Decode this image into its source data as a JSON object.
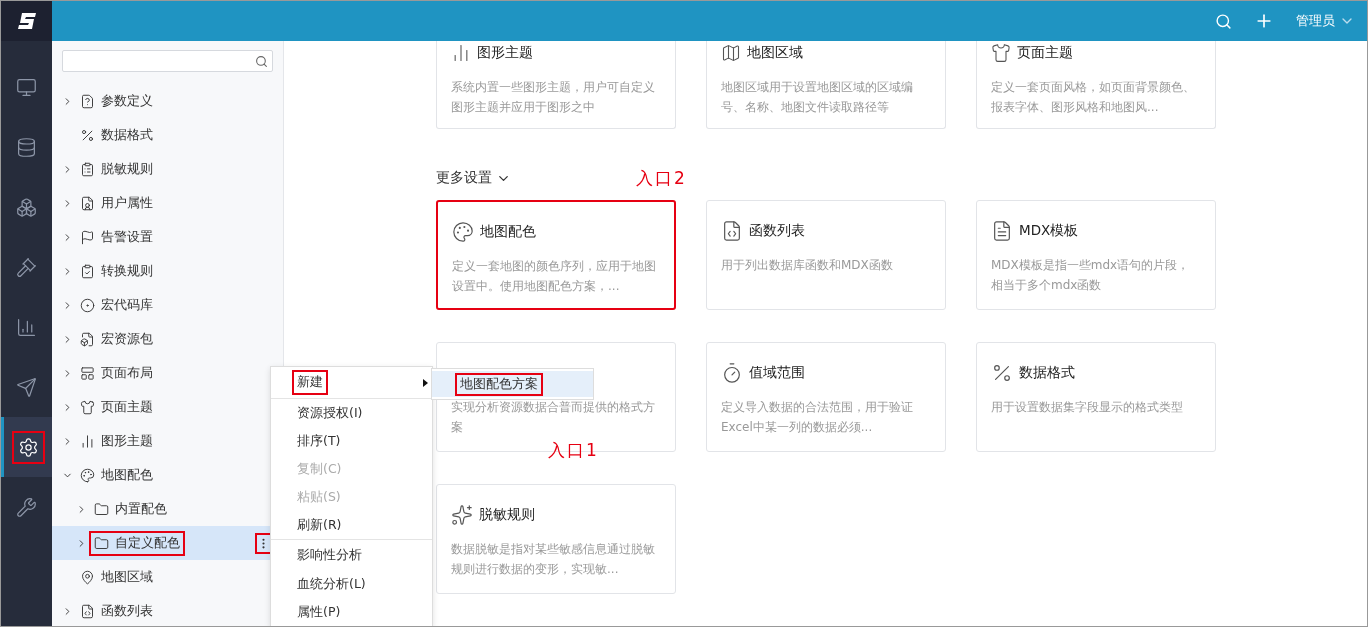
{
  "header": {
    "user": "管理员"
  },
  "rail": [
    {
      "selected": false,
      "annotated": false
    },
    {
      "selected": false,
      "annotated": false
    },
    {
      "selected": false,
      "annotated": false
    },
    {
      "selected": false,
      "annotated": false
    },
    {
      "selected": false,
      "annotated": false
    },
    {
      "selected": false,
      "annotated": false
    },
    {
      "selected": true,
      "annotated": true
    },
    {
      "selected": false,
      "annotated": false
    }
  ],
  "tree": {
    "items": [
      {
        "label": "参数定义",
        "expandable": true,
        "selected": false,
        "annotated": false
      },
      {
        "label": "数据格式",
        "expandable": false,
        "selected": false,
        "annotated": false
      },
      {
        "label": "脱敏规则",
        "expandable": true,
        "selected": false,
        "annotated": false
      },
      {
        "label": "用户属性",
        "expandable": true,
        "selected": false,
        "annotated": false
      },
      {
        "label": "告警设置",
        "expandable": true,
        "selected": false,
        "annotated": false
      },
      {
        "label": "转换规则",
        "expandable": true,
        "selected": false,
        "annotated": false
      },
      {
        "label": "宏代码库",
        "expandable": true,
        "selected": false,
        "annotated": false
      },
      {
        "label": "宏资源包",
        "expandable": true,
        "selected": false,
        "annotated": false
      },
      {
        "label": "页面布局",
        "expandable": true,
        "selected": false,
        "annotated": false
      },
      {
        "label": "页面主题",
        "expandable": true,
        "selected": false,
        "annotated": false
      },
      {
        "label": "图形主题",
        "expandable": true,
        "selected": false,
        "annotated": false
      },
      {
        "label": "地图配色",
        "expandable": true,
        "expanded": true,
        "selected": false,
        "annotated": false,
        "children": [
          {
            "label": "内置配色",
            "expandable": true,
            "selected": false,
            "annotated": false
          },
          {
            "label": "自定义配色",
            "expandable": true,
            "selected": true,
            "annotated": true,
            "more_annotated": true
          }
        ]
      },
      {
        "label": "地图区域",
        "expandable": false,
        "selected": false,
        "annotated": false
      },
      {
        "label": "函数列表",
        "expandable": true,
        "selected": false,
        "annotated": false
      }
    ]
  },
  "context_menu": {
    "items": [
      {
        "label": "新建",
        "kind": "submenu",
        "disabled": false,
        "annotated": true
      },
      {
        "label": "资源授权(I)",
        "kind": "item",
        "disabled": false,
        "annotated": false
      },
      {
        "label": "排序(T)",
        "kind": "item",
        "disabled": false,
        "annotated": false
      },
      {
        "label": "复制(C)",
        "kind": "item",
        "disabled": true,
        "annotated": false
      },
      {
        "label": "粘贴(S)",
        "kind": "item",
        "disabled": true,
        "annotated": false
      },
      {
        "label": "刷新(R)",
        "kind": "item",
        "disabled": false,
        "annotated": false
      },
      {
        "label": "影响性分析",
        "kind": "separated",
        "disabled": false,
        "annotated": false
      },
      {
        "label": "血统分析(L)",
        "kind": "item",
        "disabled": false,
        "annotated": false
      },
      {
        "label": "属性(P)",
        "kind": "item",
        "disabled": false,
        "annotated": false
      }
    ],
    "submenu": [
      {
        "label": "地图配色方案",
        "selected": true,
        "annotated": true
      }
    ]
  },
  "cards_top": [
    {
      "title": "图形主题",
      "description": "系统内置一些图形主题，用户可自定义图形主题并应用于图形之中",
      "annotated": false
    },
    {
      "title": "地图区域",
      "description": "地图区域用于设置地图区域的区域编号、名称、地图文件读取路径等",
      "annotated": false
    },
    {
      "title": "页面主题",
      "description": "定义一套页面风格，如页面背景颜色、报表字体、图形风格和地图风...",
      "annotated": false
    }
  ],
  "more_settings": {
    "label": "更多设置"
  },
  "cards_more": [
    {
      "title": "地图配色",
      "description": "定义一套地图的颜色序列，应用于地图设置中。使用地图配色方案，...",
      "annotated": true
    },
    {
      "title": "函数列表",
      "description": "用于列出数据库函数和MDX函数",
      "annotated": false
    },
    {
      "title": "MDX模板",
      "description": "MDX模板是指一些mdx语句的片段，相当于多个mdx函数",
      "annotated": false
    },
    {
      "description": "实现分析资源数据合普而提供的格式方案",
      "annotated": false
    },
    {
      "title": "值域范围",
      "description": "定义导入数据的合法范围，用于验证Excel中某一列的数据必须...",
      "annotated": false
    },
    {
      "title": "数据格式",
      "description": "用于设置数据集字段显示的格式类型",
      "annotated": false
    },
    {
      "title": "脱敏规则",
      "description": "数据脱敏是指对某些敏感信息通过脱敏规则进行数据的变形，实现敏...",
      "annotated": false
    }
  ],
  "annotations": [
    {
      "label": "入口2"
    },
    {
      "label": "入口1"
    }
  ]
}
